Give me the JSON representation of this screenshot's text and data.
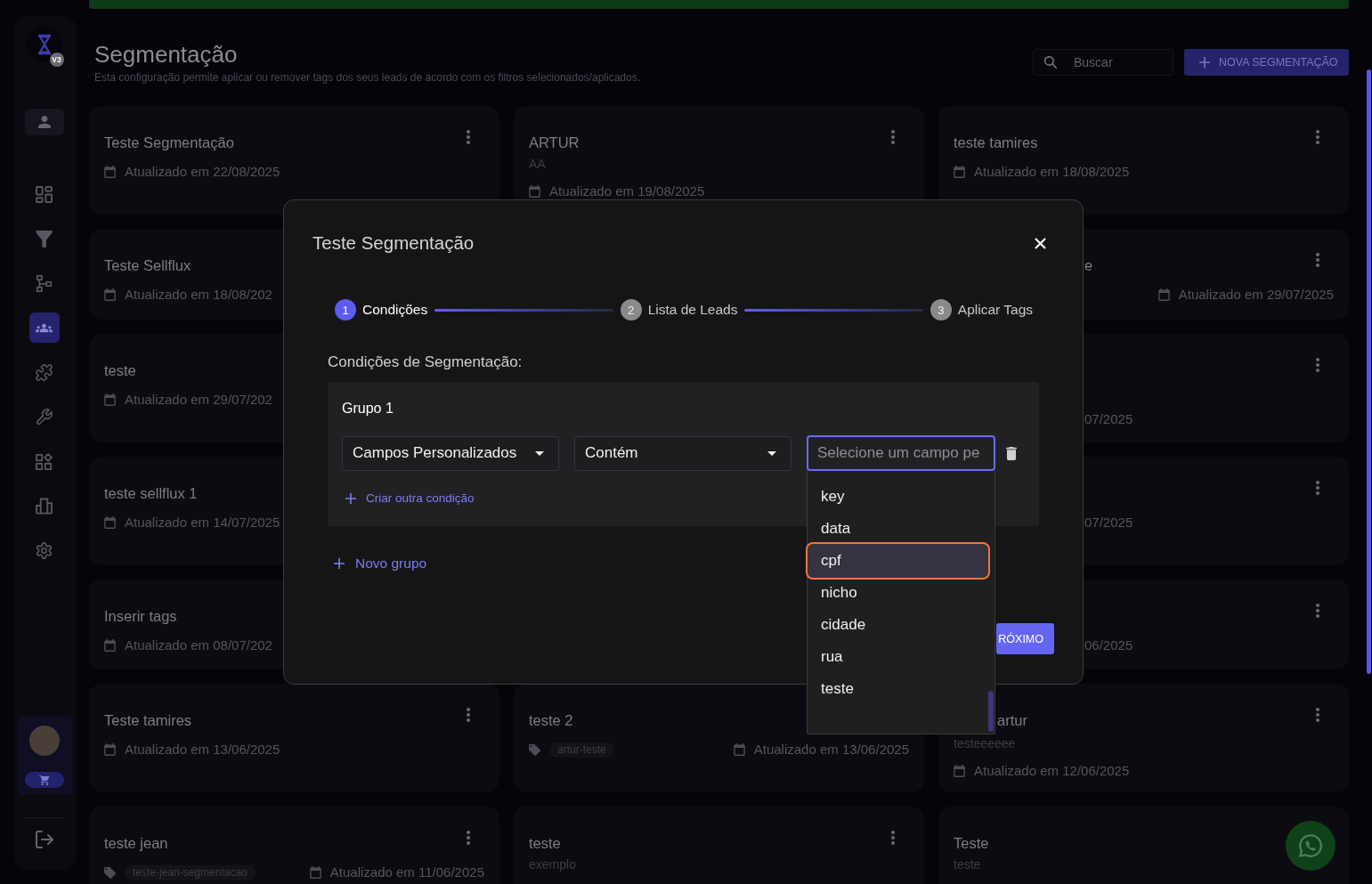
{
  "sidebar": {
    "badge": "V3",
    "nav": [
      {
        "selected": false
      },
      {
        "selected": false
      },
      {
        "selected": false
      },
      {
        "selected": true
      },
      {
        "selected": false
      },
      {
        "selected": false
      },
      {
        "selected": false
      },
      {
        "selected": false
      },
      {
        "selected": false
      }
    ]
  },
  "header": {
    "title": "Segmentação",
    "subtitle": "Esta configuração permite aplicar ou remover tags dos seus leads de acordo com os filtros selecionados/aplicados.",
    "search": {
      "placeholder": "Buscar"
    },
    "new_button": "NOVA SEGMENTAÇÃO"
  },
  "card_rows": [
    {
      "left": {
        "title": "Teste Segmentação",
        "date": "Atualizado em 22/08/2025",
        "menu_button": true
      },
      "middle": {
        "title": "ARTUR",
        "subtitle": "AA",
        "date": "Atualizado em 19/08/2025",
        "menu_button": true
      },
      "right": {
        "title": "teste tamires",
        "date": "Atualizado em 18/08/2025",
        "menu_button": true
      }
    },
    {
      "left": {
        "title": "Teste Sellflux",
        "date": "Atualizado em 18/08/202"
      },
      "right": {
        "title": "e",
        "date": "Atualizado em 29/07/2025",
        "menu_button": true
      }
    },
    {
      "left": {
        "title": "teste",
        "date": "Atualizado em 29/07/202"
      },
      "right": {
        "date": "07/2025",
        "menu_button": true
      }
    },
    {
      "left": {
        "title": "teste sellflux 1",
        "date": "Atualizado em 14/07/2025"
      },
      "right": {
        "date": "07/2025",
        "menu_button": true
      }
    },
    {
      "left": {
        "title": "Inserir tags",
        "date": "Atualizado em 08/07/202"
      },
      "right": {
        "date": "06/2025",
        "menu_button": true
      }
    },
    {
      "left": {
        "title": "Teste tamires",
        "date": "Atualizado em 13/06/2025",
        "menu_button": true
      },
      "middle": {
        "title": "teste 2",
        "tag": "artur-teste",
        "date": "Atualizado em 13/06/2025"
      },
      "right": {
        "title": "artur",
        "subtitle": "testeeeeee",
        "date": "Atualizado em 12/06/2025",
        "menu_button": true
      }
    },
    {
      "left": {
        "title": "teste jean",
        "tag": "teste-jean-segmentacao",
        "date": "Atualizado em 11/06/2025",
        "menu_button": true
      },
      "middle": {
        "title": "teste",
        "subtitle": "exemplo",
        "menu_button": true
      },
      "right": {
        "title": "Teste",
        "subtitle": "teste"
      }
    }
  ],
  "modal": {
    "title": "Teste Segmentação",
    "steps": [
      {
        "number": "1",
        "label": "Condições",
        "active": true
      },
      {
        "number": "2",
        "label": "Lista de Leads",
        "active": false
      },
      {
        "number": "3",
        "label": "Aplicar Tags",
        "active": false
      }
    ],
    "section_title": "Condições de Segmentação:",
    "groups": [
      {
        "title": "Grupo 1",
        "conditions": [
          {
            "field": "Campos Personalizados",
            "operator": "Contém",
            "value": {
              "placeholder": "Selecione um campo pe",
              "focused": true,
              "options": [
                {
                  "label": "key",
                  "highlighted": false
                },
                {
                  "label": "data",
                  "highlighted": false
                },
                {
                  "label": "cpf",
                  "highlighted": true
                },
                {
                  "label": "nicho",
                  "highlighted": false
                },
                {
                  "label": "cidade",
                  "highlighted": false
                },
                {
                  "label": "rua",
                  "highlighted": false
                },
                {
                  "label": "teste",
                  "highlighted": false
                }
              ]
            }
          }
        ],
        "add_condition": "Criar outra condição"
      }
    ],
    "add_group": "Novo grupo",
    "next_button": "RÓXIMO"
  }
}
